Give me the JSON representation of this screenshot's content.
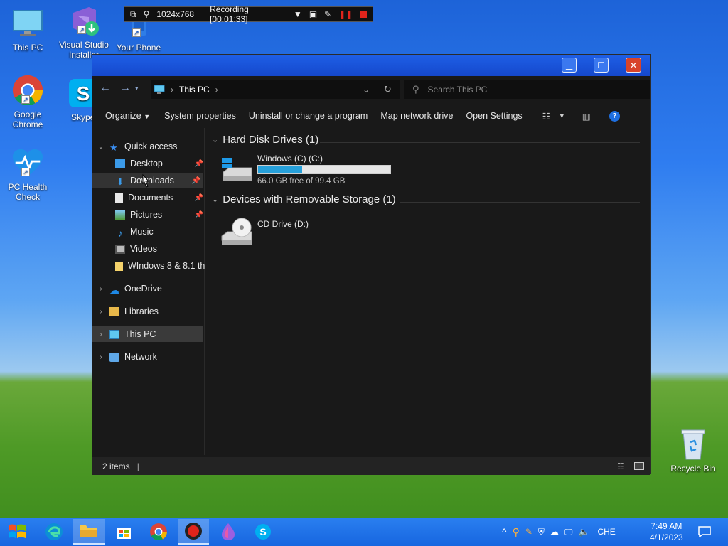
{
  "desktop": {
    "icons": [
      {
        "name": "this-pc",
        "label": "This PC"
      },
      {
        "name": "visual-studio-installer",
        "label": "Visual Studio Installer"
      },
      {
        "name": "your-phone",
        "label": "Your Phone"
      },
      {
        "name": "google-chrome",
        "label": "Google Chrome"
      },
      {
        "name": "skype",
        "label": "Skype"
      },
      {
        "name": "pc-health-check",
        "label": "PC Health Check"
      },
      {
        "name": "recycle-bin",
        "label": "Recycle Bin"
      }
    ]
  },
  "recorder": {
    "resolution": "1024x768",
    "status": "Recording [00:01:33]"
  },
  "explorer": {
    "address": {
      "location": "This PC"
    },
    "search": {
      "placeholder": "Search This PC"
    },
    "toolbar": {
      "organize": "Organize",
      "system_properties": "System properties",
      "uninstall": "Uninstall or change a program",
      "map_drive": "Map network drive",
      "open_settings": "Open Settings"
    },
    "nav": {
      "quick_access": "Quick access",
      "desktop": "Desktop",
      "downloads": "Downloads",
      "documents": "Documents",
      "pictures": "Pictures",
      "music": "Music",
      "videos": "Videos",
      "windows_folder": "WIndows 8 & 8.1 th",
      "onedrive": "OneDrive",
      "libraries": "Libraries",
      "this_pc": "This PC",
      "network": "Network"
    },
    "groups": {
      "hdd": "Hard Disk Drives (1)",
      "removable": "Devices with Removable Storage (1)"
    },
    "drives": {
      "c": {
        "name": "Windows (C) (C:)",
        "free_text": "66.0 GB free of 99.4 GB",
        "used_fraction": 0.336
      },
      "d": {
        "name": "CD Drive (D:)"
      }
    },
    "status": {
      "items": "2 items"
    }
  },
  "taskbar": {
    "clock_time": "7:49 AM",
    "clock_date": "4/1/2023",
    "language": "CHE"
  },
  "colors": {
    "titlebar": "#1548cc",
    "accent": "#26a0da",
    "close": "#d8432a"
  }
}
